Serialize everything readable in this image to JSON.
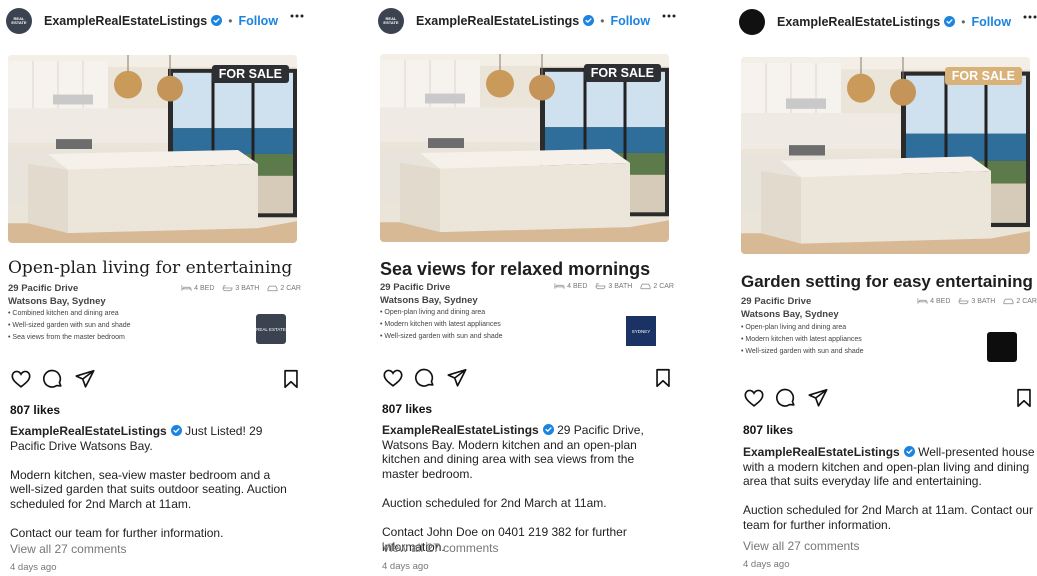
{
  "colors": {
    "link": "#1a84e0",
    "verified": "#1a84e0",
    "sale_dark": "#2d2f33",
    "sale_gold": "#d9b27a"
  },
  "posts": [
    {
      "username": "ExampleRealEstateListings",
      "follow": "Follow",
      "separator": "•",
      "avatar_text": "REAL ESTATE",
      "badge": "FOR SALE",
      "title": "Open-plan living for entertaining",
      "address_line1": "29 Pacific Drive",
      "address_line2": "Watsons Bay, Sydney",
      "features": {
        "bed": "4 BED",
        "bath": "3 BATH",
        "car": "2 CAR"
      },
      "bullets": [
        "Combined kitchen and dining area",
        "Well-sized garden with sun and shade",
        "Sea views from the master bedroom"
      ],
      "logo_text": "REAL ESTATE",
      "likes": "807 likes",
      "caption_lead": "Just Listed! 29 Pacific Drive Watsons Bay.",
      "caption_paragraphs": [
        "Modern kitchen, sea-view master bedroom and a well-sized garden that suits outdoor seating. Auction scheduled for 2nd March at 11am.",
        "Contact our team for further information."
      ],
      "view_comments": "View all 27 comments",
      "time_ago": "4 days ago"
    },
    {
      "username": "ExampleRealEstateListings",
      "follow": "Follow",
      "separator": "•",
      "avatar_text": "REAL ESTATE",
      "badge": "FOR SALE",
      "title": "Sea views for relaxed mornings",
      "address_line1": "29 Pacific Drive",
      "address_line2": "Watsons Bay, Sydney",
      "features": {
        "bed": "4 BED",
        "bath": "3 BATH",
        "car": "2 CAR"
      },
      "bullets": [
        "Open-plan living and dining area",
        "Modern kitchen with latest appliances",
        "Well-sized garden with sun and shade"
      ],
      "logo_text": "SYDNEY",
      "likes": "807 likes",
      "caption_lead": "29 Pacific Drive, Watsons Bay. Modern kitchen and an open-plan kitchen and dining area with sea views from the master bedroom.",
      "caption_paragraphs": [
        "Auction scheduled for 2nd March at 11am.",
        "Contact John Doe on 0401 219 382 for further information."
      ],
      "view_comments": "View all 27 comments",
      "time_ago": "4 days ago"
    },
    {
      "username": "ExampleRealEstateListings",
      "follow": "Follow",
      "separator": "•",
      "avatar_text": "",
      "badge": "FOR SALE",
      "title": "Garden setting for easy entertaining",
      "address_line1": "29 Pacific Drive",
      "address_line2": "Watsons Bay, Sydney",
      "features": {
        "bed": "4 BED",
        "bath": "3 BATH",
        "car": "2 CAR"
      },
      "bullets": [
        "Open-plan living and dining area",
        "Modern kitchen with latest appliances",
        "Well-sized garden with sun and shade"
      ],
      "logo_text": "",
      "likes": "807 likes",
      "caption_lead": "Well-presented house with a modern kitchen and open-plan living and dining area that suits everyday life and entertaining.",
      "caption_paragraphs": [
        "Auction scheduled for 2nd March at 11am. Contact our team for further information."
      ],
      "view_comments": "View all 27 comments",
      "time_ago": "4 days ago"
    }
  ]
}
